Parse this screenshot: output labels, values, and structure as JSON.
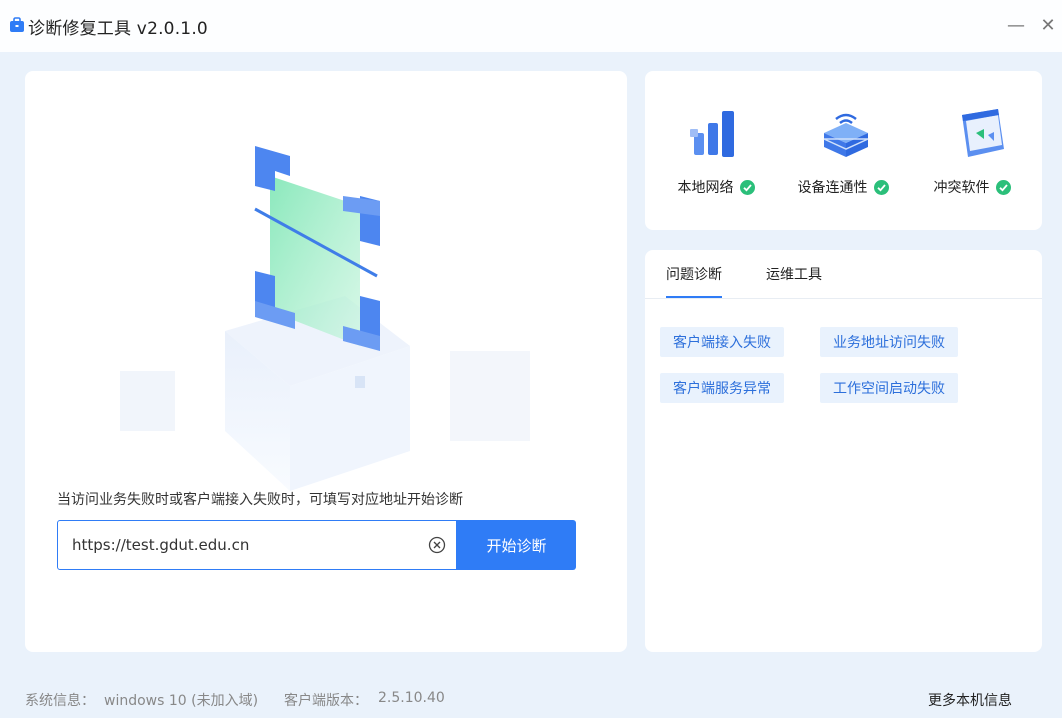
{
  "window": {
    "title": "诊断修复工具 v2.0.1.0",
    "minimize_glyph": "—",
    "close_glyph": "✕"
  },
  "status": {
    "items": [
      {
        "label": "本地网络",
        "icon": "network-signal-icon",
        "state": "ok"
      },
      {
        "label": "设备连通性",
        "icon": "router-device-icon",
        "state": "ok"
      },
      {
        "label": "冲突软件",
        "icon": "software-window-icon",
        "state": "ok"
      }
    ]
  },
  "diagnose": {
    "tabs": [
      {
        "label": "问题诊断",
        "active": true
      },
      {
        "label": "运维工具",
        "active": false
      }
    ],
    "issues": [
      "客户端接入失败",
      "业务地址访问失败",
      "客户端服务异常",
      "工作空间启动失败"
    ]
  },
  "main": {
    "hint": "当访问业务失败时或客户端接入失败时，可填写对应地址开始诊断",
    "url_value": "https://test.gdut.edu.cn",
    "start_label": "开始诊断"
  },
  "footer": {
    "system_label": "系统信息：",
    "system_value": "windows 10 (未加入域)",
    "version_label": "客户端版本：",
    "version_value": "2.5.10.40",
    "more_info": "更多本机信息"
  },
  "colors": {
    "accent": "#2f7cf6",
    "success": "#2bbf7a",
    "background": "#eaf2fb",
    "tag_bg": "#e9f2fd"
  }
}
